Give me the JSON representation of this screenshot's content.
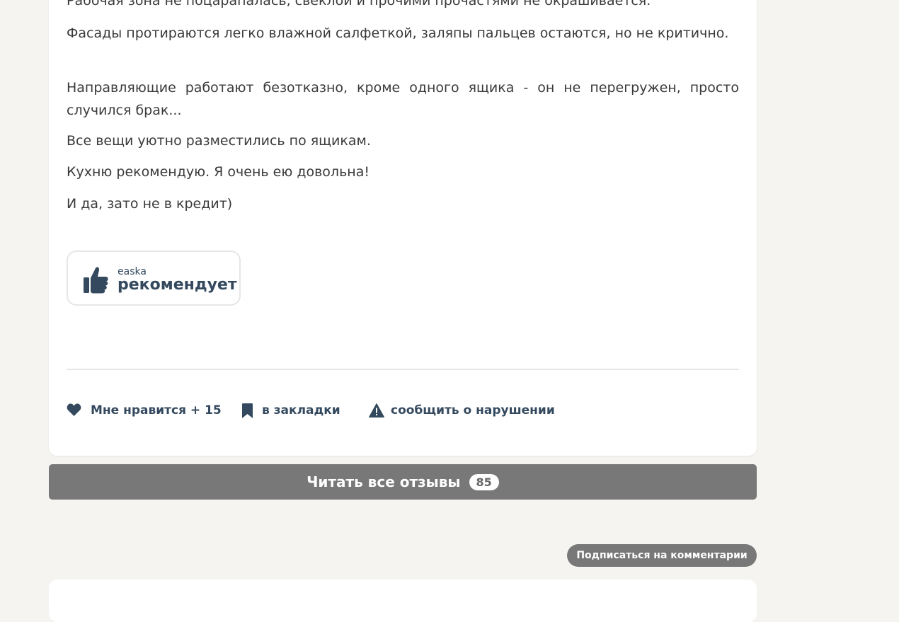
{
  "review": {
    "paragraphs": [
      "Рабочая зона не поцарапалась, свеклой и прочими прочастями не окрашивается.",
      "Фасады протираются легко влажной салфеткой, заляпы пальцев остаются, но не критично.",
      "Направляющие работают безотказно, кроме одного ящика - он не перегружен, просто случился брак...",
      "Все вещи уютно разместились по ящикам.",
      "Кухню рекомендую. Я очень ею довольна!",
      "И да, зато не в кредит)"
    ]
  },
  "recommend": {
    "user": "easka",
    "label": "рекомендует",
    "icon": "thumbs-up-icon"
  },
  "actions": {
    "like": "Мне нравится + 15",
    "bookmark": "в закладки",
    "report": "сообщить о нарушении"
  },
  "read_all": {
    "label": "Читать все отзывы",
    "count": "85"
  },
  "subscribe": {
    "label": "Подписаться на комментарии"
  },
  "colors": {
    "accent": "#34495e",
    "button_gray": "#787878",
    "background": "#f5f4f0"
  }
}
